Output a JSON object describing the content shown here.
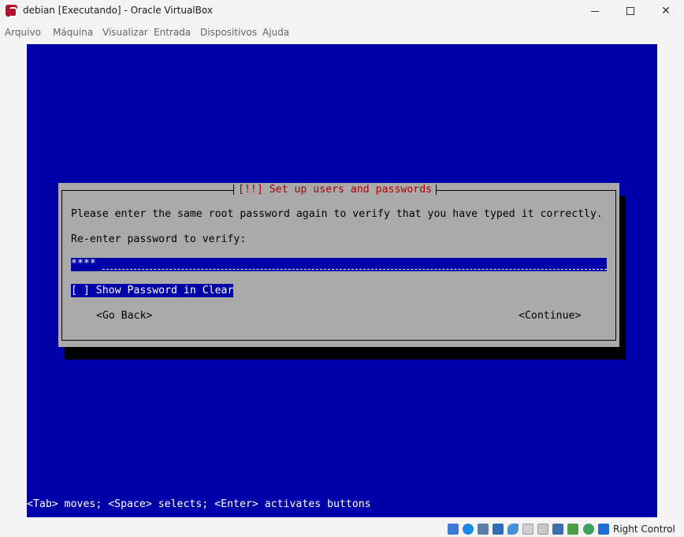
{
  "window": {
    "title": "debian [Executando] - Oracle VirtualBox",
    "minimize_glyph": "",
    "maximize_glyph": "",
    "close_glyph": "✕"
  },
  "menu": {
    "items": [
      "Arquivo",
      "Máquina",
      "Visualizar",
      "Entrada",
      "Dispositivos",
      "Ajuda"
    ]
  },
  "installer": {
    "dialog_title": "[!!] Set up users and passwords",
    "instruction": "Please enter the same root password again to verify that you have typed it correctly.",
    "field_label": "Re-enter password to verify:",
    "password_value": "****",
    "show_password_checkbox": "[ ] Show Password in Clear",
    "go_back_button": "<Go Back>",
    "continue_button": "<Continue>",
    "help_line": "<Tab> moves; <Space> selects; <Enter> activates buttons"
  },
  "colors": {
    "screen_blue": "#0000a8",
    "dialog_gray": "#aaaaaa",
    "title_red": "#a80000"
  },
  "statusbar": {
    "icons": [
      "hard-disk-icon",
      "optical-drive-icon",
      "audio-icon",
      "network-icon",
      "usb-icon",
      "shared-folders-icon",
      "display-icon",
      "screen-capture-icon",
      "video-capture-icon",
      "cpu-icon",
      "mouse-integration-icon",
      "keyboard-capture-icon"
    ],
    "host_key": "Right Control"
  }
}
